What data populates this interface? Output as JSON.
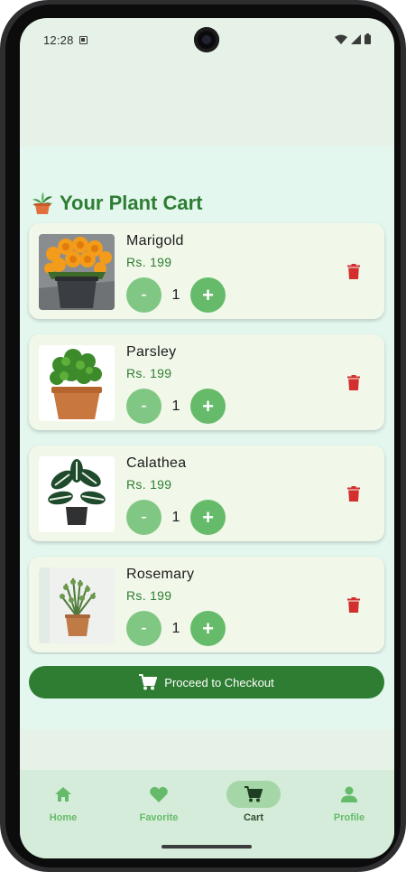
{
  "status_bar": {
    "time": "12:28",
    "icons": [
      "notification-a-icon",
      "wifi-icon",
      "signal-icon",
      "battery-icon"
    ]
  },
  "page": {
    "title": "Your Plant Cart",
    "title_icon": "potted-plant-icon"
  },
  "cart": {
    "items": [
      {
        "name": "Marigold",
        "price": "Rs. 199",
        "quantity": "1",
        "minus_label": "-",
        "plus_label": "+",
        "image": "marigold-photo"
      },
      {
        "name": "Parsley",
        "price": "Rs. 199",
        "quantity": "1",
        "minus_label": "-",
        "plus_label": "+",
        "image": "parsley-photo"
      },
      {
        "name": "Calathea",
        "price": "Rs. 199",
        "quantity": "1",
        "minus_label": "-",
        "plus_label": "+",
        "image": "calathea-photo"
      },
      {
        "name": "Rosemary",
        "price": "Rs. 199",
        "quantity": "1",
        "minus_label": "-",
        "plus_label": "+",
        "image": "rosemary-photo"
      }
    ]
  },
  "checkout": {
    "label": "Proceed to Checkout",
    "icon": "shopping-cart-icon"
  },
  "bottom_nav": {
    "items": [
      {
        "label": "Home",
        "icon": "home-icon"
      },
      {
        "label": "Favorite",
        "icon": "heart-icon"
      },
      {
        "label": "Cart",
        "icon": "shopping-cart-icon",
        "active": true
      },
      {
        "label": "Profile",
        "icon": "person-icon"
      }
    ]
  },
  "colors": {
    "primary": "#2e7d32",
    "accent": "#66bb6a",
    "card": "#f1f8e9",
    "delete": "#d32f2f",
    "background": "#e3f7ef"
  }
}
